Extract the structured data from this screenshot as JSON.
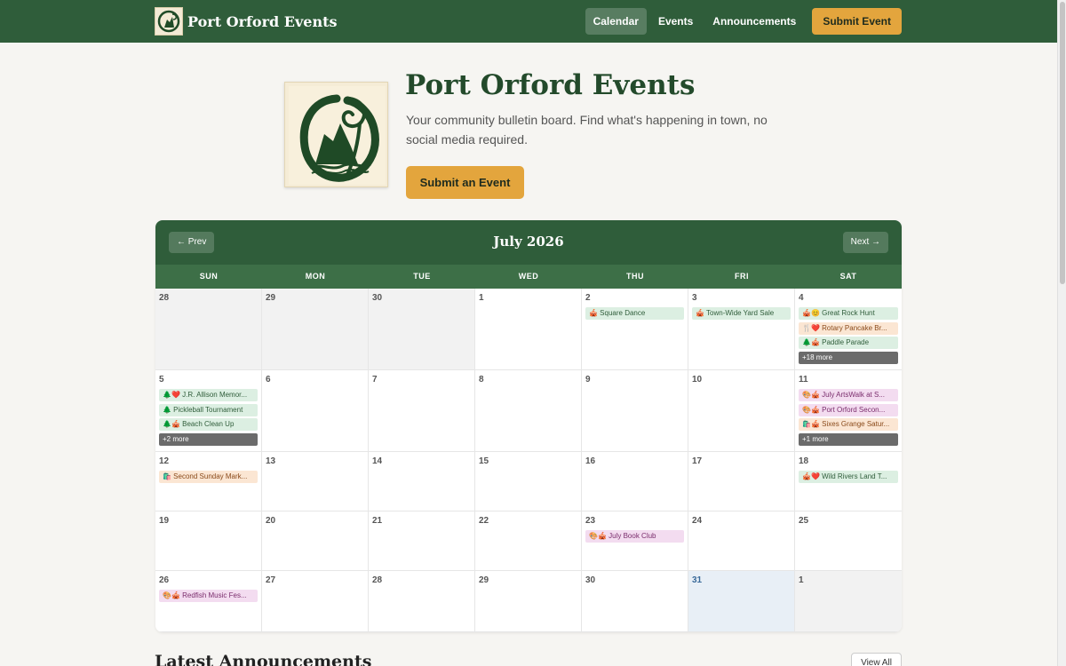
{
  "nav": {
    "brand": "Port Orford Events",
    "links": [
      "Calendar",
      "Events",
      "Announcements"
    ],
    "submit": "Submit Event"
  },
  "hero": {
    "title": "Port Orford Events",
    "tagline": "Your community bulletin board. Find what's happening in town, no social media required.",
    "button": "Submit an Event"
  },
  "calendar": {
    "title": "July 2026",
    "prev": "← Prev",
    "next": "Next →",
    "days_of_week": [
      "SUN",
      "MON",
      "TUE",
      "WED",
      "THU",
      "FRI",
      "SAT"
    ],
    "weeks": [
      [
        {
          "day": "28",
          "outside": true,
          "events": []
        },
        {
          "day": "29",
          "outside": true,
          "events": []
        },
        {
          "day": "30",
          "outside": true,
          "events": []
        },
        {
          "day": "1",
          "events": []
        },
        {
          "day": "2",
          "events": [
            {
              "label": "🎪 Square Dance",
              "color": "green"
            }
          ]
        },
        {
          "day": "3",
          "events": [
            {
              "label": "🎪 Town-Wide Yard Sale",
              "color": "green"
            }
          ]
        },
        {
          "day": "4",
          "events": [
            {
              "label": "🎪😊 Great Rock Hunt",
              "color": "green"
            },
            {
              "label": "🍴❤️ Rotary Pancake Br...",
              "color": "orange"
            },
            {
              "label": "🌲🎪 Paddle Parade",
              "color": "green"
            },
            {
              "label": "+18 more",
              "color": "more"
            }
          ]
        }
      ],
      [
        {
          "day": "5",
          "events": [
            {
              "label": "🌲❤️ J.R. Allison Memor...",
              "color": "green"
            },
            {
              "label": "🌲 Pickleball Tournament",
              "color": "green"
            },
            {
              "label": "🌲🎪 Beach Clean Up",
              "color": "green"
            },
            {
              "label": "+2 more",
              "color": "more"
            }
          ]
        },
        {
          "day": "6",
          "events": []
        },
        {
          "day": "7",
          "events": []
        },
        {
          "day": "8",
          "events": []
        },
        {
          "day": "9",
          "events": []
        },
        {
          "day": "10",
          "events": []
        },
        {
          "day": "11",
          "events": [
            {
              "label": "🎨🎪 July ArtsWalk at S...",
              "color": "pink"
            },
            {
              "label": "🎨🎪 Port Orford Secon...",
              "color": "pink"
            },
            {
              "label": "🛍️🎪 Sixes Grange Satur...",
              "color": "orange"
            },
            {
              "label": "+1 more",
              "color": "more"
            }
          ]
        }
      ],
      [
        {
          "day": "12",
          "events": [
            {
              "label": "🛍️ Second Sunday Mark...",
              "color": "orange"
            }
          ]
        },
        {
          "day": "13",
          "events": []
        },
        {
          "day": "14",
          "events": []
        },
        {
          "day": "15",
          "events": []
        },
        {
          "day": "16",
          "events": []
        },
        {
          "day": "17",
          "events": []
        },
        {
          "day": "18",
          "events": [
            {
              "label": "🎪❤️ Wild Rivers Land T...",
              "color": "green"
            }
          ]
        }
      ],
      [
        {
          "day": "19",
          "events": []
        },
        {
          "day": "20",
          "events": []
        },
        {
          "day": "21",
          "events": []
        },
        {
          "day": "22",
          "events": []
        },
        {
          "day": "23",
          "events": [
            {
              "label": "🎨🎪 July Book Club",
              "color": "pink"
            }
          ]
        },
        {
          "day": "24",
          "events": []
        },
        {
          "day": "25",
          "events": []
        }
      ],
      [
        {
          "day": "26",
          "events": [
            {
              "label": "🎨🎪 Redfish Music Fes...",
              "color": "pink"
            }
          ]
        },
        {
          "day": "27",
          "events": []
        },
        {
          "day": "28",
          "events": []
        },
        {
          "day": "29",
          "events": []
        },
        {
          "day": "30",
          "events": []
        },
        {
          "day": "31",
          "today": true,
          "events": []
        },
        {
          "day": "1",
          "outside": true,
          "events": []
        }
      ]
    ]
  },
  "announcements": {
    "title": "Latest Announcements",
    "view_all": "View All"
  },
  "colors": {
    "primary": "#2f5d3a",
    "accent": "#e3a53d",
    "background": "#f6f5f2"
  },
  "icons": {
    "logo": "fern-rock-logo-icon"
  }
}
